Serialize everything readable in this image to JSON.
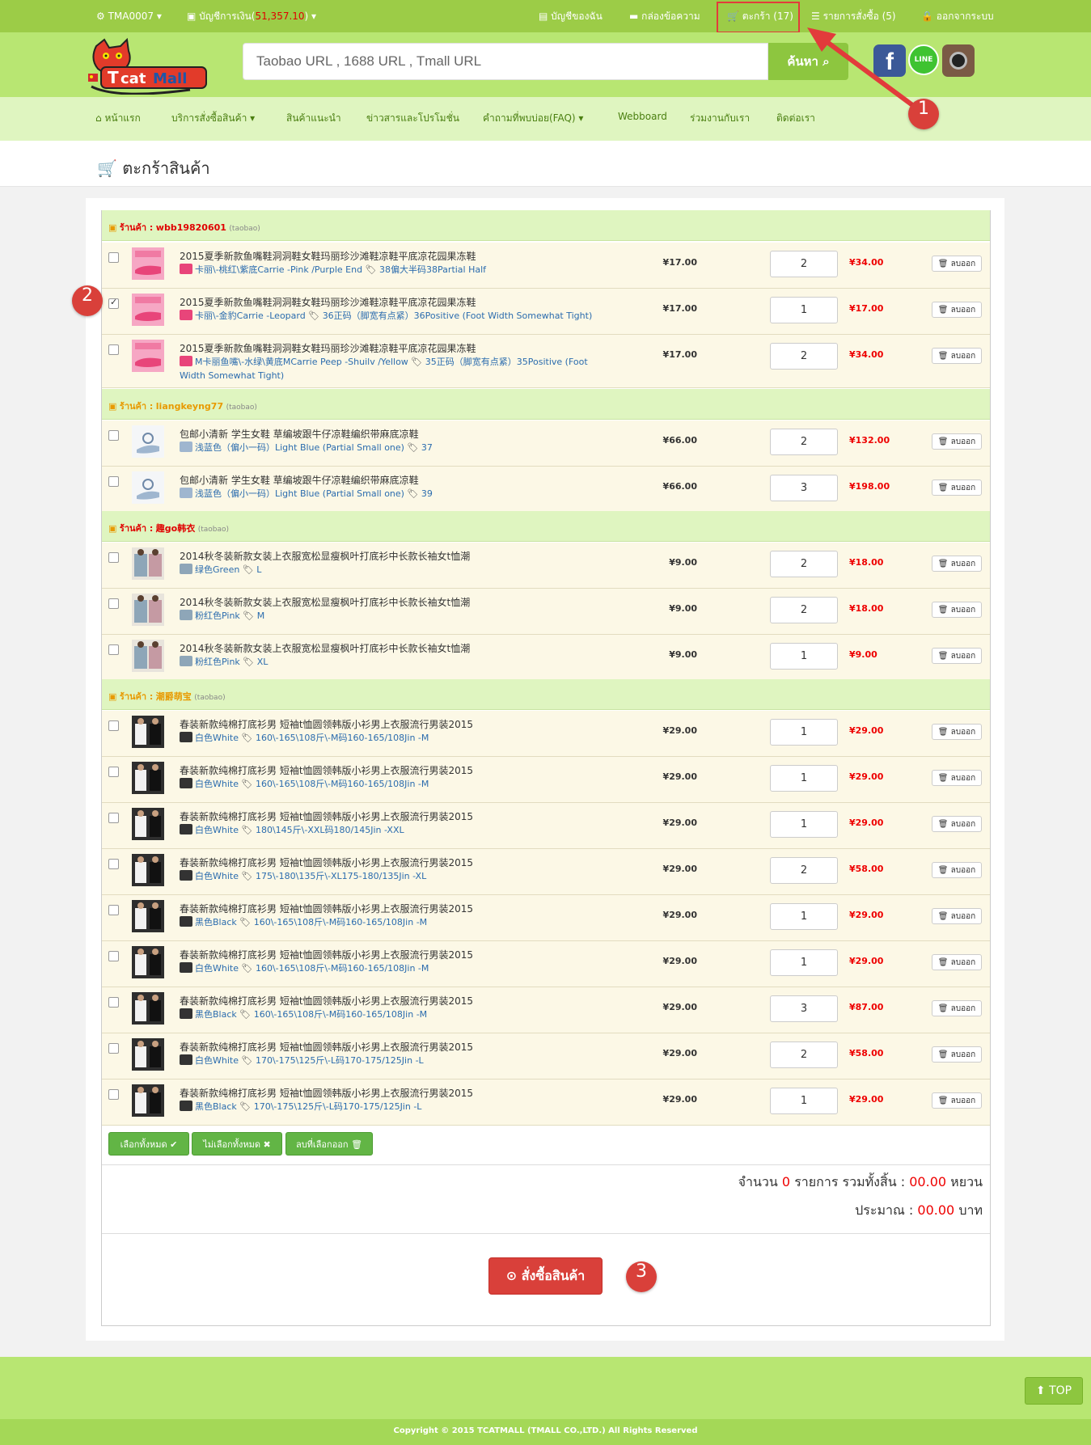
{
  "topbar": {
    "user": "TMA0007",
    "account_label": "บัญชีการเงิน",
    "account_balance": "51,357.10",
    "my_account": "บัญชีของฉัน",
    "messages": "กล่องข้อความ",
    "cart": "ตะกร้า (17)",
    "orders": "รายการสั่งซื้อ (5)",
    "logout": "ออกจากระบบ"
  },
  "search": {
    "placeholder": "Taobao URL , 1688 URL , Tmall URL",
    "button": "ค้นหา"
  },
  "nav": {
    "home": "หน้าแรก",
    "services": "บริการสั่งซื้อสินค้า",
    "recommended": "สินค้าแนะนำ",
    "news": "ข่าวสารและโปรโมชั่น",
    "faq": "คำถามที่พบบ่อย(FAQ)",
    "webboard": "Webboard",
    "careers": "ร่วมงานกับเรา",
    "contact": "ติดต่อเรา"
  },
  "page_title": "ตะกร้าสินค้า",
  "shop_label": "ร้านค้า :",
  "remove_label": "ลบออก",
  "shops": [
    {
      "name": "wbb19820601",
      "source": "(taobao)"
    },
    {
      "name": "liangkeyng77",
      "source": "(taobao)"
    },
    {
      "name": "趣go韩衣",
      "source": "(taobao)"
    },
    {
      "name": "潮爵萌宝",
      "source": "(taobao)"
    }
  ],
  "items": [
    {
      "title": "2015夏季新款鱼嘴鞋洞洞鞋女鞋玛丽珍沙滩鞋凉鞋平底凉花园果冻鞋",
      "color": "卡丽\\-桃红\\紫底Carrie -Pink /Purple End",
      "size": "38偏大半码38Partial Half",
      "price": "¥17.00",
      "qty": "2",
      "total": "¥34.00",
      "checked": false
    },
    {
      "title": "2015夏季新款鱼嘴鞋洞洞鞋女鞋玛丽珍沙滩鞋凉鞋平底凉花园果冻鞋",
      "color": "卡丽\\-金豹Carrie -Leopard",
      "size": "36正码（脚宽有点紧）36Positive (Foot Width Somewhat Tight)",
      "price": "¥17.00",
      "qty": "1",
      "total": "¥17.00",
      "checked": true
    },
    {
      "title": "2015夏季新款鱼嘴鞋洞洞鞋女鞋玛丽珍沙滩鞋凉鞋平底凉花园果冻鞋",
      "color": "M卡丽鱼嘴\\-水绿\\黄底MCarrie Peep -Shuilv /Yellow",
      "size": "35正码（脚宽有点紧）35Positive (Foot Width Somewhat Tight)",
      "price": "¥17.00",
      "qty": "2",
      "total": "¥34.00",
      "checked": false
    },
    {
      "title": "包邮小清新 学生女鞋 草编坡跟牛仔凉鞋编织带麻底凉鞋",
      "color": "浅蓝色（偏小一码）Light Blue (Partial Small one)",
      "size": "37",
      "price": "¥66.00",
      "qty": "2",
      "total": "¥132.00",
      "checked": false
    },
    {
      "title": "包邮小清新 学生女鞋 草编坡跟牛仔凉鞋编织带麻底凉鞋",
      "color": "浅蓝色（偏小一码）Light Blue (Partial Small one)",
      "size": "39",
      "price": "¥66.00",
      "qty": "3",
      "total": "¥198.00",
      "checked": false
    },
    {
      "title": "2014秋冬装新款女装上衣服宽松显瘦枫叶打底衫中长款长袖女t恤潮",
      "color": "绿色Green",
      "size": "L",
      "price": "¥9.00",
      "qty": "2",
      "total": "¥18.00",
      "checked": false
    },
    {
      "title": "2014秋冬装新款女装上衣服宽松显瘦枫叶打底衫中长款长袖女t恤潮",
      "color": "粉红色Pink",
      "size": "M",
      "price": "¥9.00",
      "qty": "2",
      "total": "¥18.00",
      "checked": false
    },
    {
      "title": "2014秋冬装新款女装上衣服宽松显瘦枫叶打底衫中长款长袖女t恤潮",
      "color": "粉红色Pink",
      "size": "XL",
      "price": "¥9.00",
      "qty": "1",
      "total": "¥9.00",
      "checked": false
    },
    {
      "title": "春装新款纯棉打底衫男 短袖t恤圆领韩版小衫男上衣服流行男装2015",
      "color": "白色White",
      "size": "160\\-165\\108斤\\-M码160-165/108Jin -M",
      "price": "¥29.00",
      "qty": "1",
      "total": "¥29.00",
      "checked": false
    },
    {
      "title": "春装新款纯棉打底衫男 短袖t恤圆领韩版小衫男上衣服流行男装2015",
      "color": "白色White",
      "size": "160\\-165\\108斤\\-M码160-165/108Jin -M",
      "price": "¥29.00",
      "qty": "1",
      "total": "¥29.00",
      "checked": false
    },
    {
      "title": "春装新款纯棉打底衫男 短袖t恤圆领韩版小衫男上衣服流行男装2015",
      "color": "白色White",
      "size": "180\\145斤\\-XXL码180/145Jin -XXL",
      "price": "¥29.00",
      "qty": "1",
      "total": "¥29.00",
      "checked": false
    },
    {
      "title": "春装新款纯棉打底衫男 短袖t恤圆领韩版小衫男上衣服流行男装2015",
      "color": "白色White",
      "size": "175\\-180\\135斤\\-XL175-180/135Jin -XL",
      "price": "¥29.00",
      "qty": "2",
      "total": "¥58.00",
      "checked": false
    },
    {
      "title": "春装新款纯棉打底衫男 短袖t恤圆领韩版小衫男上衣服流行男装2015",
      "color": "黑色Black",
      "size": "160\\-165\\108斤\\-M码160-165/108Jin -M",
      "price": "¥29.00",
      "qty": "1",
      "total": "¥29.00",
      "checked": false
    },
    {
      "title": "春装新款纯棉打底衫男 短袖t恤圆领韩版小衫男上衣服流行男装2015",
      "color": "白色White",
      "size": "160\\-165\\108斤\\-M码160-165/108Jin -M",
      "price": "¥29.00",
      "qty": "1",
      "total": "¥29.00",
      "checked": false
    },
    {
      "title": "春装新款纯棉打底衫男 短袖t恤圆领韩版小衫男上衣服流行男装2015",
      "color": "黑色Black",
      "size": "160\\-165\\108斤\\-M码160-165/108Jin -M",
      "price": "¥29.00",
      "qty": "3",
      "total": "¥87.00",
      "checked": false
    },
    {
      "title": "春装新款纯棉打底衫男 短袖t恤圆领韩版小衫男上衣服流行男装2015",
      "color": "白色White",
      "size": "170\\-175\\125斤\\-L码170-175/125Jin -L",
      "price": "¥29.00",
      "qty": "2",
      "total": "¥58.00",
      "checked": false
    },
    {
      "title": "春装新款纯棉打底衫男 短袖t恤圆领韩版小衫男上衣服流行男装2015",
      "color": "黑色Black",
      "size": "170\\-175\\125斤\\-L码170-175/125Jin -L",
      "price": "¥29.00",
      "qty": "1",
      "total": "¥29.00",
      "checked": false
    }
  ],
  "actions": {
    "select_all": "เลือกทั้งหมด",
    "deselect_all": "ไม่เลือกทั้งหมด",
    "delete_selected": "ลบที่เลือกออก"
  },
  "summary": {
    "count_prefix": "จำนวน",
    "count": "0",
    "count_mid": "รายการ รวมทั้งสิ้น :",
    "total_yuan": "00.00",
    "yuan_unit": "หยวน",
    "approx_label": "ประมาณ :",
    "total_baht": "00.00",
    "baht_unit": "บาท"
  },
  "order_button": "สั่งซื้อสินค้า",
  "annotations": [
    "1",
    "2",
    "3"
  ],
  "social": {
    "line": "LINE"
  },
  "footer": {
    "top_button": "TOP",
    "copyright": "Copyright © 2015 TCATMALL (TMALL CO.,LTD.) All Rights Reserved"
  },
  "colors": {
    "brand_green": "#9ccc47",
    "header_green": "#b8e672",
    "accent_red": "#d9403a",
    "price_red": "#e00000"
  }
}
